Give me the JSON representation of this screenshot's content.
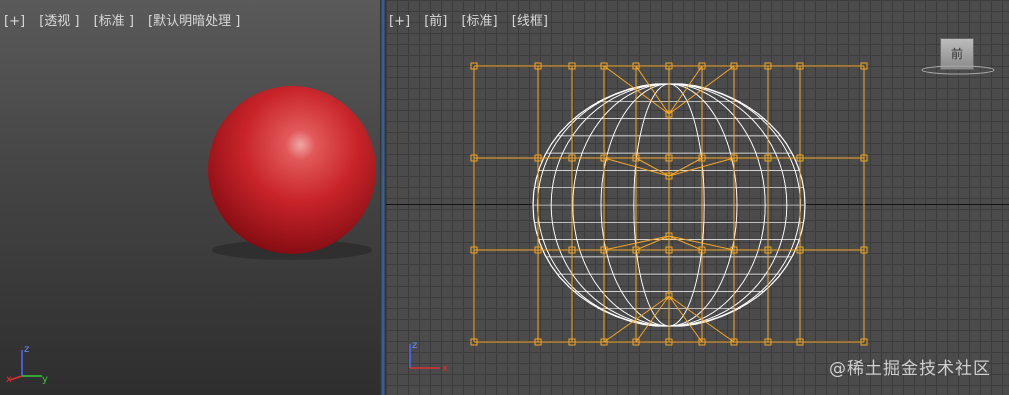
{
  "left_viewport": {
    "labels": [
      "[+]",
      "[透视 ]",
      "[标准 ]",
      "[默认明暗处理 ]"
    ],
    "gizmo": {
      "z": "z",
      "x": "x",
      "y": "y"
    }
  },
  "right_viewport": {
    "labels": [
      "[+]",
      "[前]",
      "[标准]",
      "[线框]"
    ],
    "viewcube_label": "前",
    "gizmo": {
      "z": "z",
      "x": "x"
    }
  },
  "watermark": "@稀土掘金技术社区",
  "colors": {
    "sphere": "#c8242a",
    "lattice": "#f5a623",
    "wireframe": "#ffffff",
    "divider": "#3e5f8a"
  },
  "icons": [
    "axis-gizmo-icon",
    "viewcube-icon"
  ]
}
